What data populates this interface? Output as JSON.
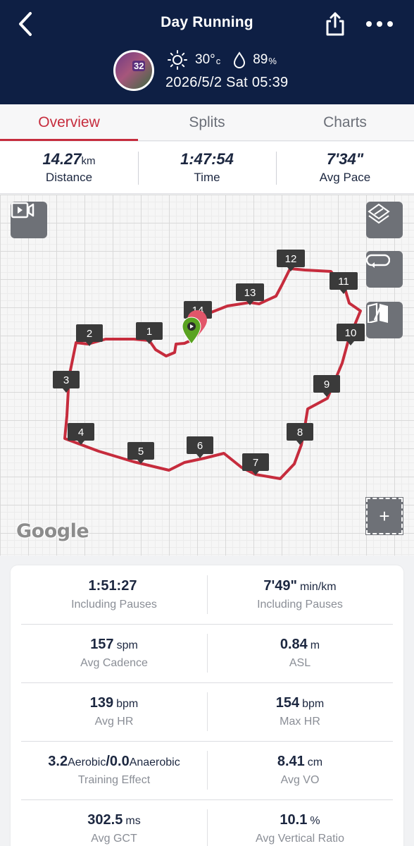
{
  "header": {
    "title": "Day Running",
    "avatar_badge": "32",
    "temperature": "30°",
    "temperature_unit": "c",
    "humidity": "89",
    "humidity_unit": "%",
    "datetime": "2026/5/2 Sat 05:39",
    "colors": {
      "background": "#0e1f44"
    }
  },
  "tabs": [
    {
      "label": "Overview",
      "active": true
    },
    {
      "label": "Splits",
      "active": false
    },
    {
      "label": "Charts",
      "active": false
    }
  ],
  "summary": {
    "distance_value": "14.27",
    "distance_unit": "km",
    "distance_label": "Distance",
    "time_value": "1:47:54",
    "time_label": "Time",
    "pace_value": "7'34\"",
    "pace_label": "Avg Pace"
  },
  "map": {
    "route_color": "#c62c3d",
    "markers": [
      "1",
      "2",
      "3",
      "4",
      "5",
      "6",
      "7",
      "8",
      "9",
      "10",
      "11",
      "12",
      "13",
      "14"
    ],
    "attribution": "Google",
    "plus_label": "+"
  },
  "stats": [
    {
      "left": {
        "value": "1:51:27",
        "unit": "",
        "label": "Including Pauses"
      },
      "right": {
        "value": "7'49\"",
        "unit": "min/km",
        "label": "Including Pauses"
      }
    },
    {
      "left": {
        "value": "157",
        "unit": "spm",
        "label": "Avg Cadence"
      },
      "right": {
        "value": "0.84",
        "unit": "m",
        "label": "ASL"
      }
    },
    {
      "left": {
        "value": "139",
        "unit": "bpm",
        "label": "Avg HR"
      },
      "right": {
        "value": "154",
        "unit": "bpm",
        "label": "Max HR"
      }
    },
    {
      "left": {
        "value": "3.2",
        "unit": "Aerobic",
        "value2": "/0.0",
        "unit2": "Anaerobic",
        "label": "Training Effect"
      },
      "right": {
        "value": "8.41",
        "unit": "cm",
        "label": "Avg VO"
      }
    },
    {
      "left": {
        "value": "302.5",
        "unit": "ms",
        "label": "Avg GCT"
      },
      "right": {
        "value": "10.1",
        "unit": "%",
        "label": "Avg Vertical Ratio"
      }
    }
  ]
}
